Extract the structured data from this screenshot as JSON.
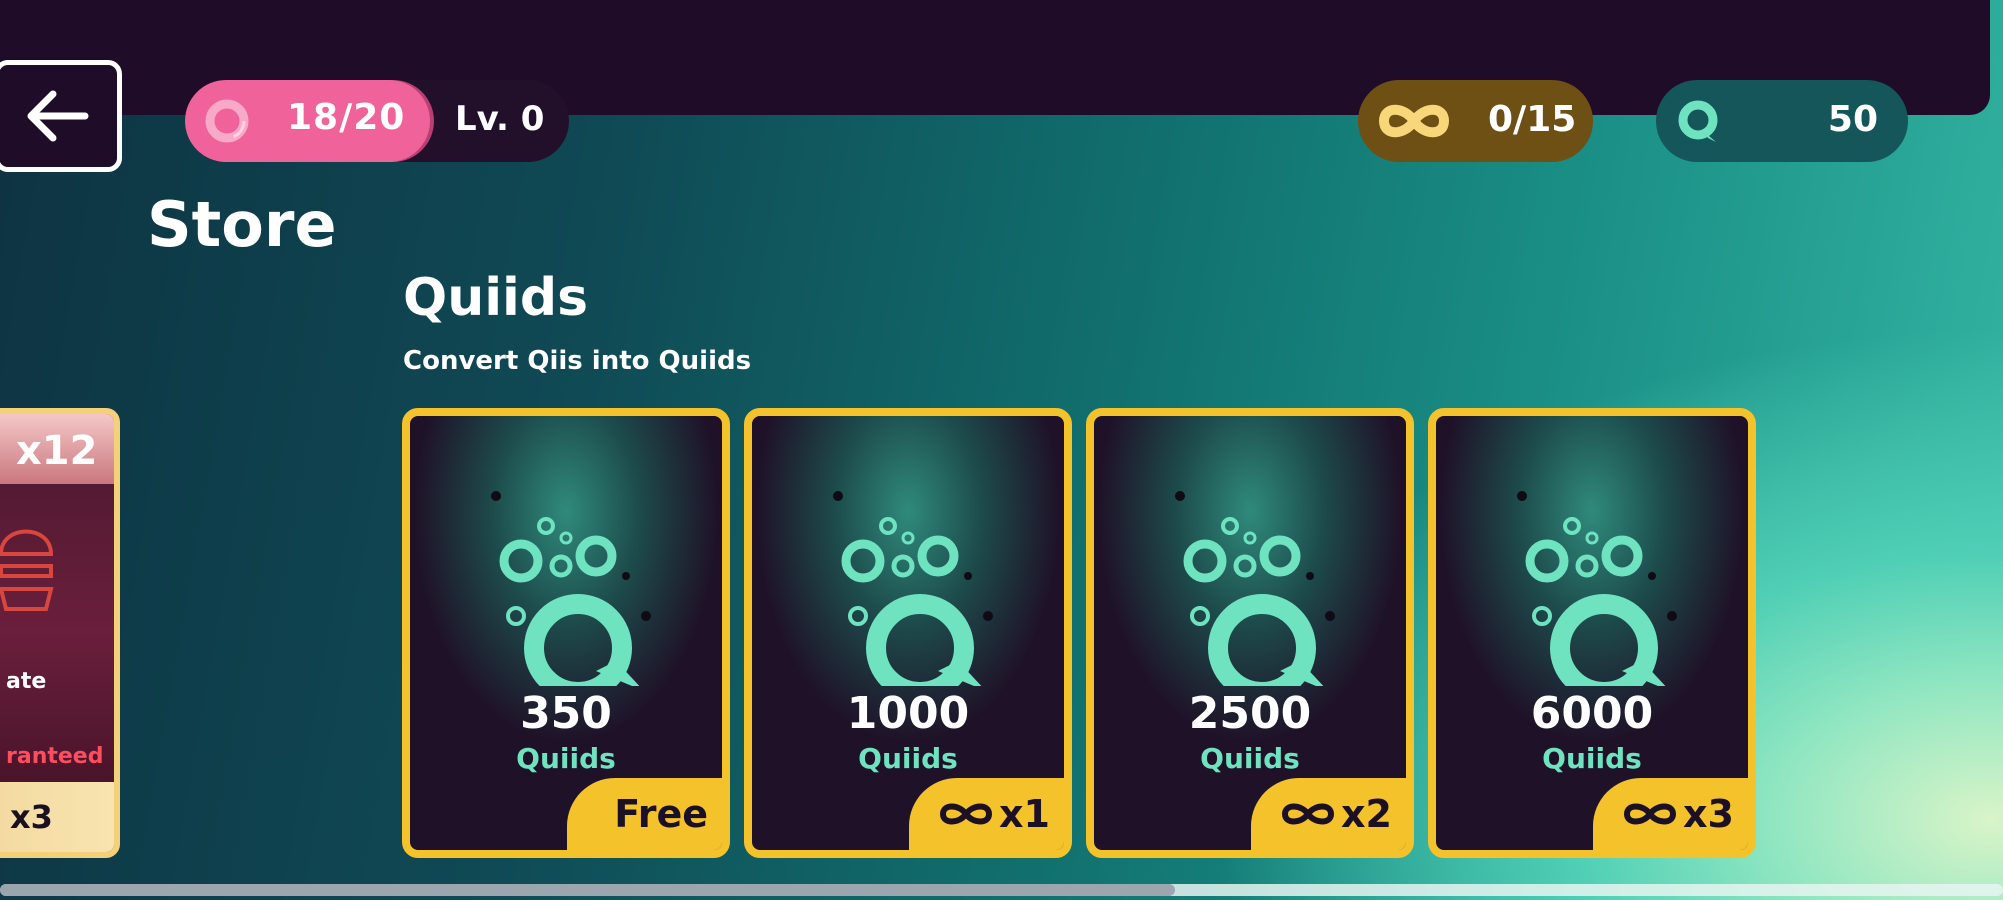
{
  "header": {
    "energy": "18/20",
    "level": "Lv. 0",
    "keys": "0/15",
    "coins": "50"
  },
  "store": {
    "title": "Store"
  },
  "section": {
    "title": "Quiids",
    "subtitle": "Convert Qiis into Quiids"
  },
  "partial_card": {
    "count": "x12",
    "label": "ate",
    "note": "ranteed",
    "cost": "x3"
  },
  "cards": [
    {
      "amount": "350",
      "unit": "Quiids",
      "price": "Free",
      "free": true
    },
    {
      "amount": "1000",
      "unit": "Quiids",
      "price": "x1",
      "free": false
    },
    {
      "amount": "2500",
      "unit": "Quiids",
      "price": "x2",
      "free": false
    },
    {
      "amount": "6000",
      "unit": "Quiids",
      "price": "x3",
      "free": false
    }
  ],
  "colors": {
    "topbar": "#1f0c28",
    "energy_pill": "#f0629a",
    "keys_pill": "#6e4f14",
    "coin_pill": "#14565a",
    "card_border": "#f4c22b",
    "quiid_teal": "#6fe3c0"
  },
  "icons": {
    "back": "arrow-left-icon",
    "energy": "energy-ring-icon",
    "keys": "infinity-key-icon",
    "coin": "quiid-coin-icon",
    "card_art": "quiid-bubbles-icon"
  }
}
